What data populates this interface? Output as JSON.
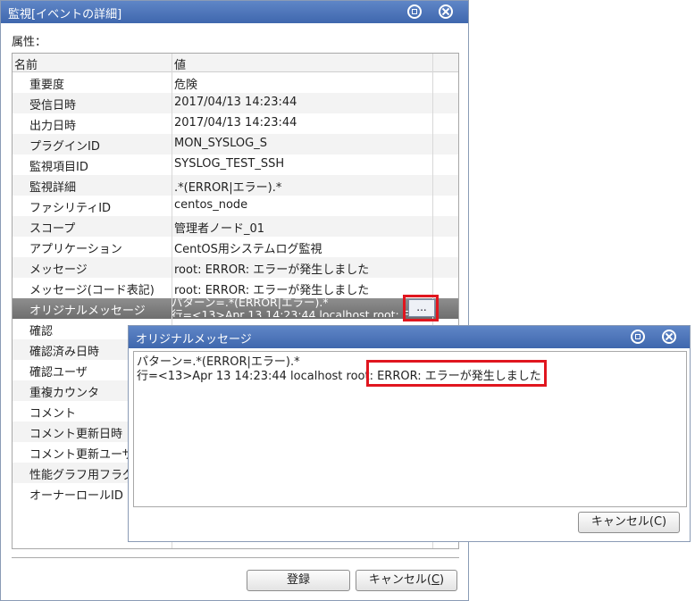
{
  "main_window": {
    "title": "監視[イベントの詳細]",
    "attributes_label": "属性：",
    "columns": {
      "name": "名前",
      "value": "値"
    },
    "rows": [
      {
        "name": "重要度",
        "value": "危険"
      },
      {
        "name": "受信日時",
        "value": "2017/04/13 14:23:44"
      },
      {
        "name": "出力日時",
        "value": "2017/04/13 14:23:44"
      },
      {
        "name": "プラグインID",
        "value": "MON_SYSLOG_S"
      },
      {
        "name": "監視項目ID",
        "value": "SYSLOG_TEST_SSH"
      },
      {
        "name": "監視詳細",
        "value": ".*(ERROR|エラー).*"
      },
      {
        "name": "ファシリティID",
        "value": "centos_node"
      },
      {
        "name": "スコープ",
        "value": "管理者ノード_01"
      },
      {
        "name": "アプリケーション",
        "value": "CentOS用システムログ監視"
      },
      {
        "name": "メッセージ",
        "value": "root: ERROR: エラーが発生しました"
      },
      {
        "name": "メッセージ(コード表記)",
        "value": "root: ERROR: エラーが発生しました"
      },
      {
        "name": "オリジナルメッセージ",
        "value_line1": "パターン=.*(ERROR|エラー).*",
        "value_line2": "行=<13>Apr 13 14:23:44 localhost root: ERROR: エラーが発生しました"
      },
      {
        "name": "確認",
        "value": ""
      },
      {
        "name": "確認済み日時",
        "value": ""
      },
      {
        "name": "確認ユーザ",
        "value": ""
      },
      {
        "name": "重複カウンタ",
        "value": ""
      },
      {
        "name": "コメント",
        "value": ""
      },
      {
        "name": "コメント更新日時",
        "value": ""
      },
      {
        "name": "コメント更新ユーザ",
        "value": ""
      },
      {
        "name": "性能グラフ用フラグ",
        "value": ""
      },
      {
        "name": "オーナーロールID",
        "value": ""
      }
    ],
    "ellipsis_label": "...",
    "register_label": "登録",
    "cancel_label": "キャンセル(",
    "cancel_key": "C",
    "cancel_close": ")"
  },
  "popup": {
    "title": "オリジナルメッセージ",
    "line1": "パターン=.*(ERROR|エラー).*",
    "line2": "行=<13>Apr 13 14:23:44 localhost root: ERROR: エラーが発生しました",
    "cancel_label": "キャンセル(C)"
  },
  "colors": {
    "titlebar": "#4a72b8",
    "highlight": "#e0161f",
    "selected_row": "#7e7e7e"
  }
}
